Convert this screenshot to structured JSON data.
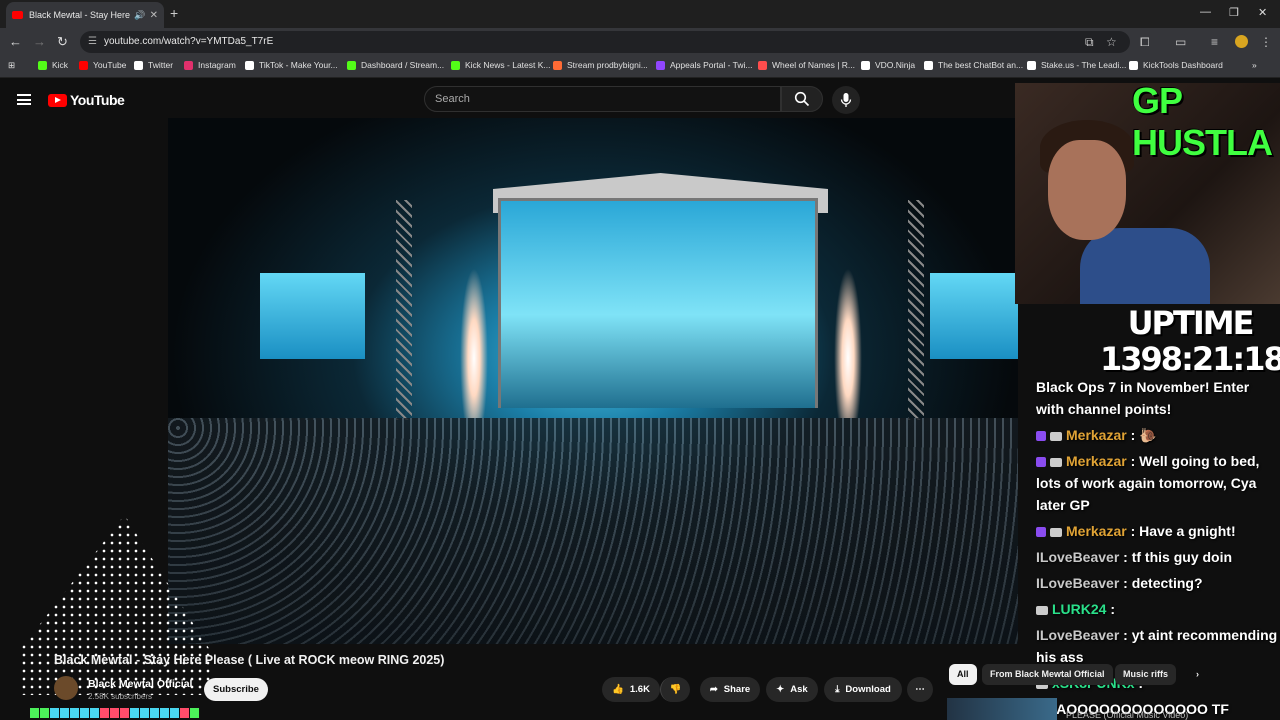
{
  "browser": {
    "tab_title": "Black Mewtal - Stay Here Pl",
    "url": "youtube.com/watch?v=YMTDa5_T7rE",
    "bookmarks": [
      {
        "label": "Kick",
        "color": "#53fc18"
      },
      {
        "label": "YouTube",
        "color": "#ff0000"
      },
      {
        "label": "Twitter",
        "color": "#ffffff"
      },
      {
        "label": "Instagram",
        "color": "#e1306c"
      },
      {
        "label": "TikTok - Make Your...",
        "color": "#ffffff"
      },
      {
        "label": "Dashboard / Stream...",
        "color": "#53fc18"
      },
      {
        "label": "Kick News - Latest K...",
        "color": "#53fc18"
      },
      {
        "label": "Stream prodbybigni...",
        "color": "#ff6b35"
      },
      {
        "label": "Appeals Portal - Twi...",
        "color": "#9146ff"
      },
      {
        "label": "Wheel of Names | R...",
        "color": "#ff4d4d"
      },
      {
        "label": "VDO.Ninja",
        "color": "#ffffff"
      },
      {
        "label": "The best ChatBot an...",
        "color": "#ffffff"
      },
      {
        "label": "Stake.us - The Leadi...",
        "color": "#ffffff"
      },
      {
        "label": "KickTools Dashboard",
        "color": "#ffffff"
      }
    ]
  },
  "youtube": {
    "logo": "YouTube",
    "search_placeholder": "Search",
    "video_title": "Black Mewtal - Stay Here Please ( Live at ROCK meow RING 2025)",
    "channel_name": "Black Mewtal Official",
    "subscribers": "2.58K subscribers",
    "subscribe_label": "Subscribe",
    "likes": "1.6K",
    "share_label": "Share",
    "ask_label": "Ask",
    "download_label": "Download",
    "chips": [
      "All",
      "From Black Mewtal Official",
      "Music riffs"
    ],
    "up_next_title": "PLEASE (Official Music Video)"
  },
  "overlay": {
    "banner": "GP HUSTLA",
    "uptime_label": "UPTIME",
    "uptime_value": "1398:21:18",
    "chat": [
      {
        "user": "",
        "text": "Black Ops 7 in November! Enter with channel points!"
      },
      {
        "user": "Merkazar",
        "text": " : 🐌"
      },
      {
        "user": "Merkazar",
        "text": " : Well going to bed, lots of work again tomorrow, Cya later GP"
      },
      {
        "user": "Merkazar",
        "text": " : Have a gnight!"
      },
      {
        "user": "ILoveBeaver",
        "text": " : tf this guy doin"
      },
      {
        "user": "ILoveBeaver",
        "text": " : detecting?"
      },
      {
        "user": "LURK24",
        "text": " : "
      },
      {
        "user": "ILoveBeaver",
        "text": " : yt aint recommending his ass"
      },
      {
        "user": "xSK8PUNKx",
        "text": " :"
      },
      {
        "user": "",
        "text": "LMAOOOOOOOOOOOOO TF"
      }
    ]
  }
}
